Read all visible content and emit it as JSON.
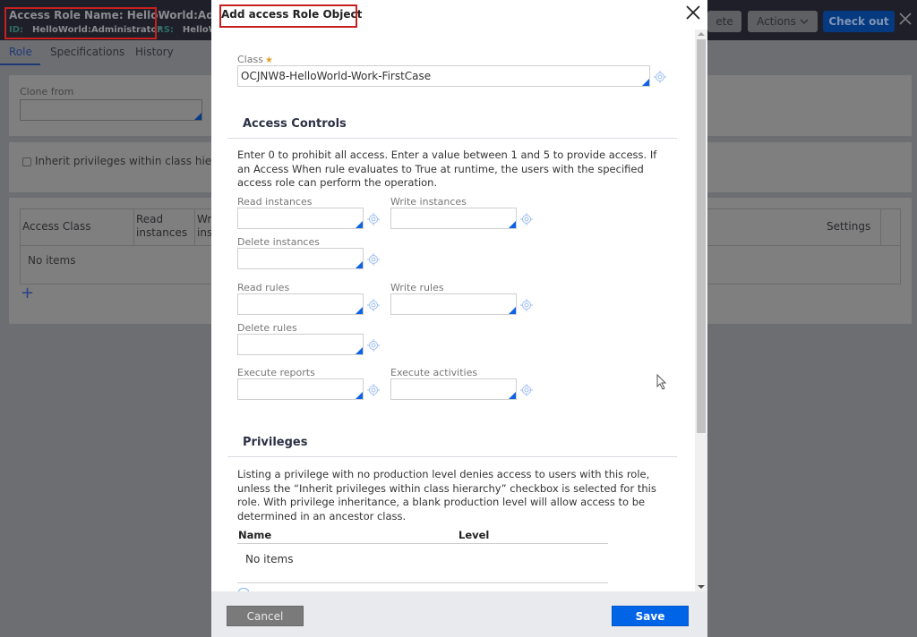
{
  "background": {
    "header": {
      "title": "Access Role Name: HelloWorld:Administ",
      "id_label": "ID:",
      "id_value": "HelloWorld:Administrator",
      "rs_label": "RS:",
      "rs_value": "HelloWo",
      "buttons": {
        "delete_label": "ete",
        "actions_label": "Actions",
        "checkout_label": "Check out"
      }
    },
    "tabs": [
      {
        "label": "Role",
        "active": true
      },
      {
        "label": "Specifications",
        "active": false
      },
      {
        "label": "History",
        "active": false
      }
    ],
    "clone_from": {
      "label": "Clone from",
      "value": ""
    },
    "inherit_checkbox": {
      "label": "Inherit privileges within class hierarch",
      "checked": false
    },
    "table": {
      "columns": [
        "Access Class",
        "Read instances",
        "Wri ins",
        "Settings"
      ],
      "empty_text": "No items"
    }
  },
  "modal": {
    "title": "Add access Role Object",
    "class_field": {
      "label": "Class",
      "required": true,
      "value": "OCJNW8-HelloWorld-Work-FirstCase"
    },
    "access_controls": {
      "heading": "Access Controls",
      "description": "Enter 0 to prohibit all access. Enter a value between 1 and 5 to provide access. If an Access When rule evaluates to True at runtime, the users with the specified access role can perform the operation.",
      "fields": {
        "read_instances": {
          "label": "Read instances",
          "value": ""
        },
        "write_instances": {
          "label": "Write instances",
          "value": ""
        },
        "delete_instances": {
          "label": "Delete instances",
          "value": ""
        },
        "read_rules": {
          "label": "Read rules",
          "value": ""
        },
        "write_rules": {
          "label": "Write rules",
          "value": ""
        },
        "delete_rules": {
          "label": "Delete rules",
          "value": ""
        },
        "execute_reports": {
          "label": "Execute reports",
          "value": ""
        },
        "execute_activities": {
          "label": "Execute activities",
          "value": ""
        }
      }
    },
    "privileges": {
      "heading": "Privileges",
      "description": "Listing a privilege with no production level denies access to users with this role, unless the “Inherit privileges within class hierarchy” checkbox is selected for this role. With privilege inheritance, a blank production level will allow access to be determined in an ancestor class.",
      "columns": [
        "Name",
        "Level"
      ],
      "empty_text": "No items"
    },
    "footer": {
      "cancel_label": "Cancel",
      "save_label": "Save"
    }
  },
  "colors": {
    "primary_button": "#0064e6",
    "header_bg": "#1f1f29",
    "highlight_box": "#c62020"
  }
}
